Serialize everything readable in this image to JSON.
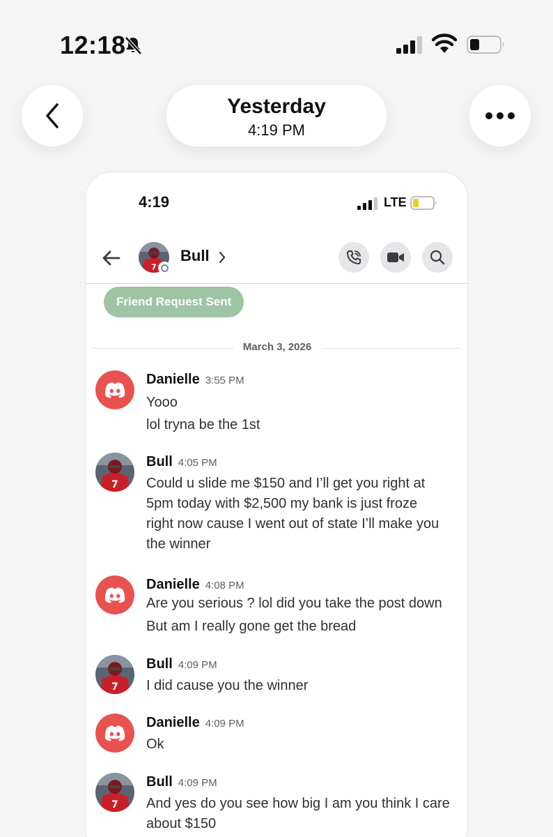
{
  "os_status": {
    "time": "12:18"
  },
  "header": {
    "date": "Yesterday",
    "time": "4:19 PM"
  },
  "inner_status": {
    "time": "4:19",
    "network": "LTE"
  },
  "chat": {
    "contact_name": "Bull",
    "friend_request_label": "Friend Request Sent"
  },
  "date_divider": "March 3, 2026",
  "colors": {
    "discord_red": "#e8524f",
    "friend_green": "#9ec4a4",
    "muted": "#5c5e66"
  },
  "messages": [
    {
      "author": "Danielle",
      "time": "3:55 PM",
      "avatar": "discord-logo-icon",
      "lines": [
        "Yooo",
        "lol tryna be the 1st"
      ]
    },
    {
      "author": "Bull",
      "time": "4:05 PM",
      "avatar": "football-player-photo",
      "lines": [
        "Could u slide  me $150 and I’ll get you right at",
        "5pm today  with $2,500  my bank  is just froze",
        "right now cause I went out of state I’ll make you",
        "the winner"
      ]
    },
    {
      "author": "Danielle",
      "time": "4:08 PM",
      "avatar": "discord-logo-icon",
      "lines": [
        "Are you serious ? lol did you take the post down",
        "But am I really gone get the bread"
      ]
    },
    {
      "author": "Bull",
      "time": "4:09 PM",
      "avatar": "football-player-photo",
      "lines": [
        "I did cause you the winner"
      ]
    },
    {
      "author": "Danielle",
      "time": "4:09 PM",
      "avatar": "discord-logo-icon",
      "lines": [
        "Ok"
      ]
    },
    {
      "author": "Bull",
      "time": "4:09 PM",
      "avatar": "football-player-photo",
      "lines": [
        "And yes do you see how big I am you think I care",
        "about $150"
      ]
    }
  ]
}
